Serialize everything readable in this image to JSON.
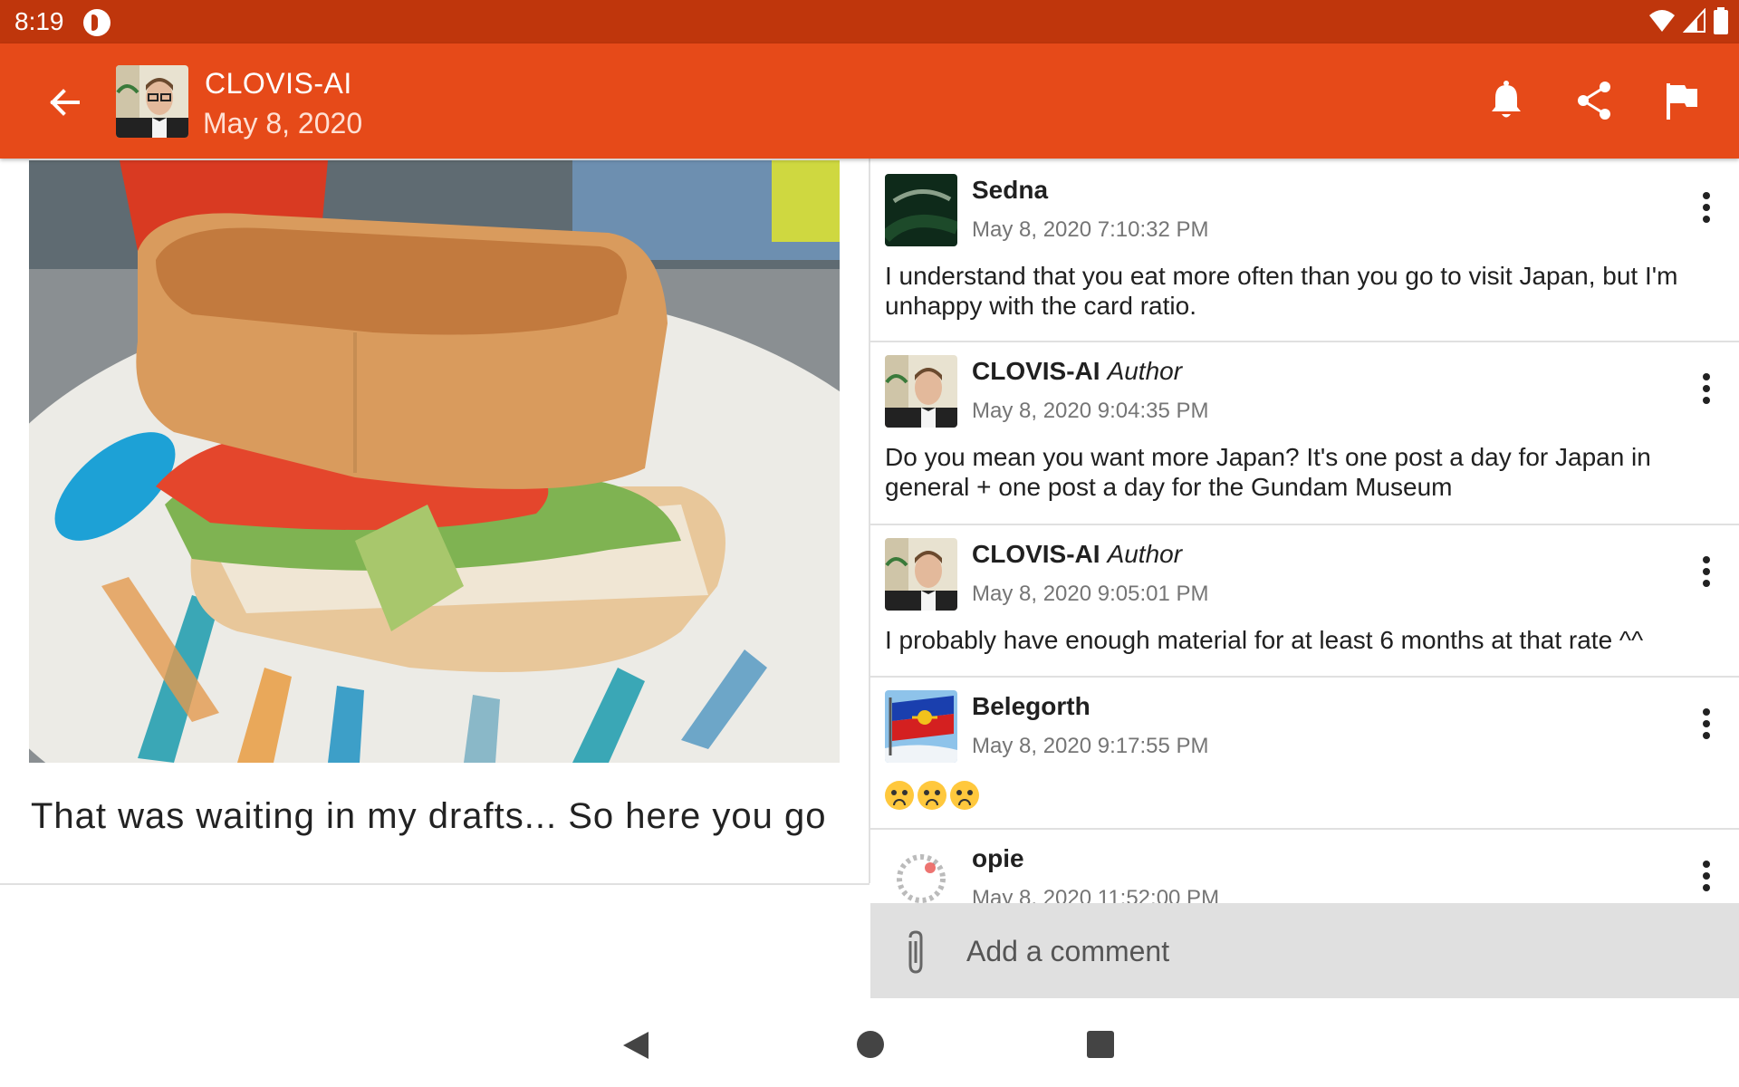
{
  "status_bar": {
    "time": "8:19"
  },
  "app_bar": {
    "author": "CLOVIS-AI",
    "date": "May 8, 2020",
    "background": "#e64a19",
    "status_background": "#bf360c"
  },
  "post": {
    "caption": "That was waiting in my drafts... So here you go"
  },
  "comments": [
    {
      "author": "Sedna",
      "badge": "",
      "time": "May 8, 2020 7:10:32 PM",
      "text": "I understand that you eat more often than you go to visit Japan, but I'm unhappy with the card ratio."
    },
    {
      "author": "CLOVIS-AI",
      "badge": "Author",
      "time": "May 8, 2020 9:04:35 PM",
      "text": "Do you mean you want more Japan? It's one post a day for Japan in general + one post a day for the Gundam Museum"
    },
    {
      "author": "CLOVIS-AI",
      "badge": "Author",
      "time": "May 8, 2020 9:05:01 PM",
      "text": "I probably have enough material for at least 6 months at that rate ^^"
    },
    {
      "author": "Belegorth",
      "badge": "",
      "time": "May 8, 2020 9:17:55 PM",
      "text": ""
    },
    {
      "author": "opie",
      "badge": "",
      "time": "May 8, 2020 11:52:00 PM",
      "text": ""
    }
  ],
  "comment_input": {
    "placeholder": "Add a comment"
  }
}
